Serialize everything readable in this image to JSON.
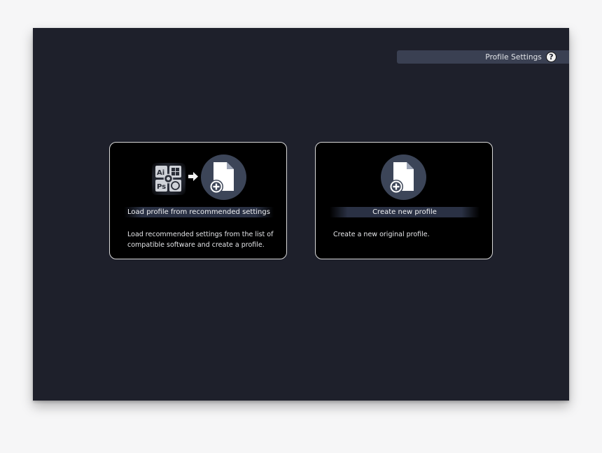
{
  "header": {
    "title": "Profile Settings",
    "help_glyph": "?"
  },
  "cards": [
    {
      "label": "Load profile from recommended settings",
      "description": "Load recommended settings from the list of compatible software and create a profile.",
      "icons": [
        "software-apps-icon",
        "arrow-right-icon",
        "new-document-icon"
      ]
    },
    {
      "label": "Create new profile",
      "description": "Create a new original profile.",
      "icons": [
        "new-document-icon"
      ]
    }
  ],
  "colors": {
    "background": "#1e202b",
    "card": "#000000",
    "accent": "#3c4558"
  }
}
